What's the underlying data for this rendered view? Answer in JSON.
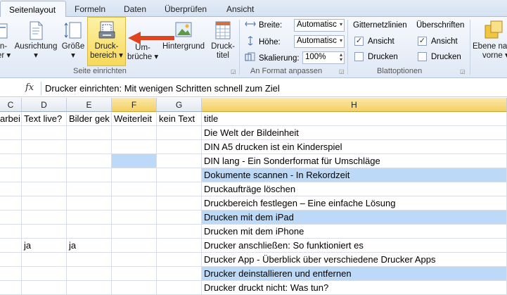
{
  "tabs": [
    "Seitenlayout",
    "Formeln",
    "Daten",
    "Überprüfen",
    "Ansicht"
  ],
  "ribbon": {
    "buttons": [
      {
        "line1": "n-",
        "line2": "er ▾"
      },
      {
        "line1": "Ausrichtung",
        "line2": "▾"
      },
      {
        "line1": "Größe",
        "line2": "▾"
      },
      {
        "line1": "Druck-",
        "line2": "bereich ▾"
      },
      {
        "line1": "Um-",
        "line2": "brüche ▾"
      },
      {
        "line1": "Hintergrund",
        "line2": ""
      },
      {
        "line1": "Druck-",
        "line2": "titel"
      }
    ],
    "group_seite": "Seite einrichten",
    "scale": {
      "breite_label": "Breite:",
      "breite_value": "Automatisc",
      "hoehe_label": "Höhe:",
      "hoehe_value": "Automatisc",
      "skalierung_label": "Skalierung:",
      "skalierung_value": "100%",
      "group": "An Format anpassen"
    },
    "sheet_options": {
      "gitter_title": "Gitternetzlinien",
      "gitter_ansicht": "Ansicht",
      "gitter_drucken": "Drucken",
      "ueber_title": "Überschriften",
      "ueber_ansicht": "Ansicht",
      "ueber_drucken": "Drucken",
      "group": "Blattoptionen"
    },
    "ebene": {
      "line1": "Ebene na",
      "line2": "vorne ▾"
    }
  },
  "formula_bar": {
    "fx": "fx",
    "content": "Drucker einrichten: Mit wenigen Schritten schnell zum Ziel"
  },
  "columns": [
    "C",
    "D",
    "E",
    "F",
    "G",
    "H"
  ],
  "header_row": [
    "arbei",
    "Text live?",
    "Bilder gek",
    "Weiterleit",
    "kein Text",
    "title"
  ],
  "rows": [
    {
      "d": "",
      "e": "",
      "title": "Die Welt der Bildeinheit",
      "f_fill": false,
      "h_fill": false
    },
    {
      "d": "",
      "e": "",
      "title": "DIN A5 drucken ist ein Kinderspiel",
      "f_fill": false,
      "h_fill": false
    },
    {
      "d": "",
      "e": "",
      "title": "DIN lang - Ein Sonderformat für Umschläge",
      "f_fill": true,
      "h_fill": false
    },
    {
      "d": "",
      "e": "",
      "title": "Dokumente scannen - In Rekordzeit",
      "f_fill": false,
      "h_fill": true
    },
    {
      "d": "",
      "e": "",
      "title": "Druckaufträge löschen",
      "f_fill": false,
      "h_fill": false
    },
    {
      "d": "",
      "e": "",
      "title": "Druckbereich festlegen – Eine einfache Lösung",
      "f_fill": false,
      "h_fill": false
    },
    {
      "d": "",
      "e": "",
      "title": "Drucken mit dem iPad",
      "f_fill": false,
      "h_fill": true
    },
    {
      "d": "",
      "e": "",
      "title": "Drucken mit dem iPhone",
      "f_fill": false,
      "h_fill": false
    },
    {
      "d": "ja",
      "e": "ja",
      "title": "Drucker anschließen: So funktioniert es",
      "f_fill": false,
      "h_fill": false
    },
    {
      "d": "",
      "e": "",
      "title": "Drucker App - Überblick über verschiedene Drucker Apps",
      "f_fill": false,
      "h_fill": false
    },
    {
      "d": "",
      "e": "",
      "title": "Drucker deinstallieren und entfernen",
      "f_fill": false,
      "h_fill": true
    },
    {
      "d": "",
      "e": "",
      "title": "Drucker druckt nicht: Was tun?",
      "f_fill": false,
      "h_fill": false
    }
  ],
  "colors": {
    "selection_fill": "#bcd9f7",
    "highlight": "#f6d85a",
    "arrow": "#e0441f"
  }
}
